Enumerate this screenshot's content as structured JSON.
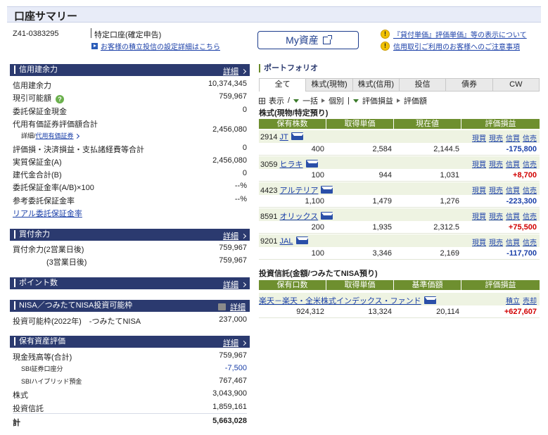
{
  "page_title": "口座サマリー",
  "account": {
    "number": "Z41-0383295",
    "type": "特定口座(確定申告)",
    "settings_link": "お客様の積立投信の設定詳細はこちら"
  },
  "my_asset_button": "My資産",
  "notices": [
    "『貸付単価』評価単価』等の表示について",
    "信用取引ご利用のお客様へのご注意事項"
  ],
  "detail_label": "詳細",
  "margin": {
    "header": "信用建余力",
    "rows": [
      {
        "label": "信用建余力",
        "value": "10,374,345"
      },
      {
        "label": "現引可能額",
        "value": "759,967"
      },
      {
        "label": "委託保証金現金",
        "value": "0"
      },
      {
        "label": "代用有価証券評価額合計",
        "value": "2,456,080"
      },
      {
        "label": "評価損・決済損益・支払諸経費等合計",
        "value": "0"
      },
      {
        "label": "実質保証金(A)",
        "value": "2,456,080"
      },
      {
        "label": "建代金合計(B)",
        "value": "0"
      },
      {
        "label": "委託保証金率(A/B)×100",
        "value": "--%"
      },
      {
        "label": "参考委託保証金率",
        "value": "--%"
      }
    ],
    "sub_detail_prefix": "詳細/",
    "sub_detail_link": "代用有価証券",
    "realtime_link": "リアル委託保証金率"
  },
  "buying": {
    "header": "買付余力",
    "rows": [
      {
        "label": "買付余力(2営業日後)",
        "value": "759,967"
      },
      {
        "label": "(3営業日後)",
        "value": "759,967"
      }
    ]
  },
  "points": {
    "header": "ポイント数"
  },
  "nisa": {
    "header": "NISA／つみたてNISA投資可能枠",
    "row_label": "投資可能枠(2022年)　-つみたてNISA",
    "row_value": "237,000"
  },
  "holdings": {
    "header": "保有資産評価",
    "rows": [
      {
        "label": "現金残高等(合計)",
        "value": "759,967"
      },
      {
        "label": "SBI証券口座分",
        "value": "-7,500"
      },
      {
        "label": "SBIハイブリッド預金",
        "value": "767,467"
      },
      {
        "label": "株式",
        "value": "3,043,900"
      },
      {
        "label": "投資信託",
        "value": "1,859,161"
      },
      {
        "label": "計",
        "value": "5,663,028"
      }
    ]
  },
  "portfolio": {
    "header": "ポートフォリオ",
    "tabs": [
      "全て",
      "株式(現物)",
      "株式(信用)",
      "投信",
      "債券",
      "CW"
    ],
    "toolbar": {
      "display": "表示",
      "all_at_once": "一括",
      "individual": "個別",
      "eval_pl": "評価損益",
      "eval_amount": "評価額"
    },
    "stocks_title": "株式(現物/特定預り)",
    "stock_columns": [
      "保有株数",
      "取得単価",
      "現在値",
      "評価損益"
    ],
    "actions": [
      "現買",
      "現売",
      "信買",
      "信売"
    ],
    "stocks": [
      {
        "code": "2914",
        "name": "JT",
        "qty": "400",
        "cost": "2,584",
        "price": "2,144.5",
        "pl": "-175,800",
        "sign": "neg"
      },
      {
        "code": "3059",
        "name": "ヒラキ",
        "qty": "100",
        "cost": "944",
        "price": "1,031",
        "pl": "+8,700",
        "sign": "pos"
      },
      {
        "code": "4423",
        "name": "アルテリア",
        "qty": "1,100",
        "cost": "1,479",
        "price": "1,276",
        "pl": "-223,300",
        "sign": "neg"
      },
      {
        "code": "8591",
        "name": "オリックス",
        "qty": "200",
        "cost": "1,935",
        "price": "2,312.5",
        "pl": "+75,500",
        "sign": "pos"
      },
      {
        "code": "9201",
        "name": "JAL",
        "qty": "100",
        "cost": "3,346",
        "price": "2,169",
        "pl": "-117,700",
        "sign": "neg"
      }
    ],
    "funds_title": "投資信託(金額/つみたてNISA預り)",
    "fund_columns": [
      "保有口数",
      "取得単価",
      "基準価額",
      "評価損益"
    ],
    "fund_actions": [
      "積立",
      "売却"
    ],
    "funds": [
      {
        "name": "楽天－楽天・全米株式インデックス・ファンド",
        "qty": "924,312",
        "cost": "13,324",
        "price": "20,114",
        "pl": "+627,607"
      }
    ]
  }
}
